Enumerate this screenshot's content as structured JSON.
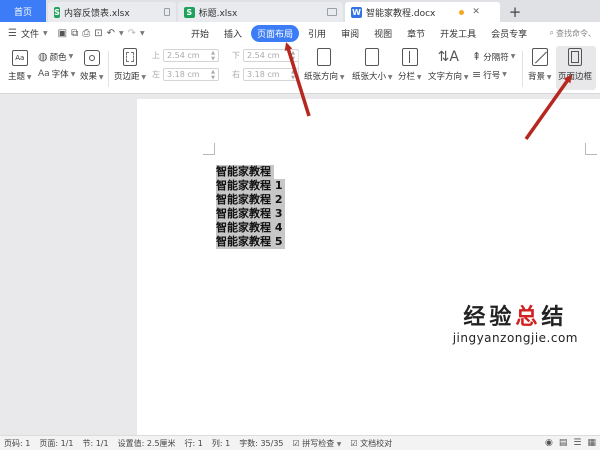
{
  "tabs": {
    "home": "首页",
    "items": [
      {
        "label": "内容反馈表.xlsx",
        "icon": "S"
      },
      {
        "label": "标题.xlsx",
        "icon": "S"
      },
      {
        "label": "智能家教程.docx",
        "icon": "W"
      }
    ],
    "add": "+"
  },
  "menu": {
    "file": "文件",
    "tabs": [
      "开始",
      "插入",
      "页面布局",
      "引用",
      "审阅",
      "视图",
      "章节",
      "开发工具",
      "会员专享"
    ],
    "active_tab": "页面布局",
    "search": "查找命令、"
  },
  "ribbon": {
    "theme": "主题",
    "colors": "颜色",
    "font": "字体",
    "effects": "效果",
    "margins": "页边距",
    "top_label": "上",
    "top_value": "2.54 cm",
    "bottom_label": "下",
    "bottom_value": "2.54 cm",
    "left_label": "左",
    "left_value": "3.18 cm",
    "right_label": "右",
    "right_value": "3.18 cm",
    "orientation": "纸张方向",
    "paper_size": "纸张大小",
    "columns": "分栏",
    "text_direction": "文字方向",
    "breaks": "分隔符",
    "line_numbers": "行号",
    "background": "背景",
    "page_border": "页面边框"
  },
  "document": {
    "lines": [
      "智能家教程",
      "智能家教程 1",
      "智能家教程 2",
      "智能家教程 3",
      "智能家教程 4",
      "智能家教程 5"
    ]
  },
  "watermark": {
    "cn_part1": "经验",
    "cn_part2": "总",
    "cn_part3": "结",
    "en": "jingyanzongjie.com"
  },
  "status": {
    "page_code": "页码: 1",
    "pages": "页面: 1/1",
    "section": "节: 1/1",
    "setting": "设置值: 2.5厘米",
    "row": "行: 1",
    "col": "列: 1",
    "words": "字数: 35/35",
    "spell": "拼写检查",
    "proof": "文档校对"
  },
  "colors": {
    "accent": "#3c7cf6",
    "arrow": "#b5271f",
    "selection": "#c7c7c7"
  }
}
